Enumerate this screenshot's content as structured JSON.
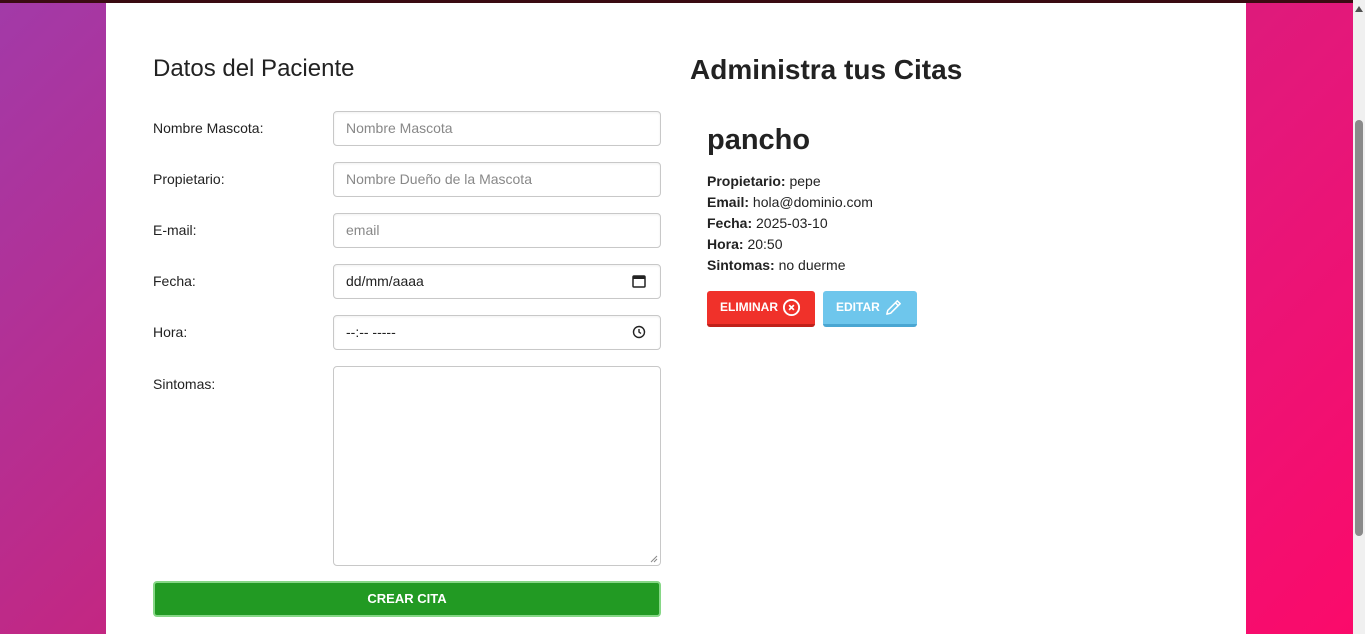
{
  "form": {
    "title": "Datos del Paciente",
    "fields": [
      {
        "label": "Nombre Mascota:",
        "placeholder": "Nombre Mascota"
      },
      {
        "label": "Propietario:",
        "placeholder": "Nombre Dueño de la Mascota"
      },
      {
        "label": "E-mail:",
        "placeholder": "email"
      },
      {
        "label": "Fecha:",
        "placeholder": "dd/mm/aaaa",
        "icon": "calendar-icon"
      },
      {
        "label": "Hora:",
        "placeholder": "--:-- -----",
        "icon": "clock-icon"
      },
      {
        "label": "Sintomas:",
        "value": ""
      }
    ],
    "submit_label": "CREAR CITA",
    "submit_color": "#229a23"
  },
  "list": {
    "title": "Administra tus Citas",
    "citas": [
      {
        "mascota": "pancho",
        "propietario_label": "Propietario:",
        "propietario": "pepe",
        "email_label": "Email:",
        "email": "hola@dominio.com",
        "fecha_label": "Fecha:",
        "fecha": "2025-03-10",
        "hora_label": "Hora:",
        "hora": "20:50",
        "sintomas_label": "Sintomas:",
        "sintomas": "no duerme",
        "delete_label": "ELIMINAR",
        "delete_icon": "x-circle-icon",
        "delete_color": "#f0312a",
        "edit_label": "EDITAR",
        "edit_icon": "pencil-icon",
        "edit_color": "#6ec6ec"
      }
    ]
  }
}
